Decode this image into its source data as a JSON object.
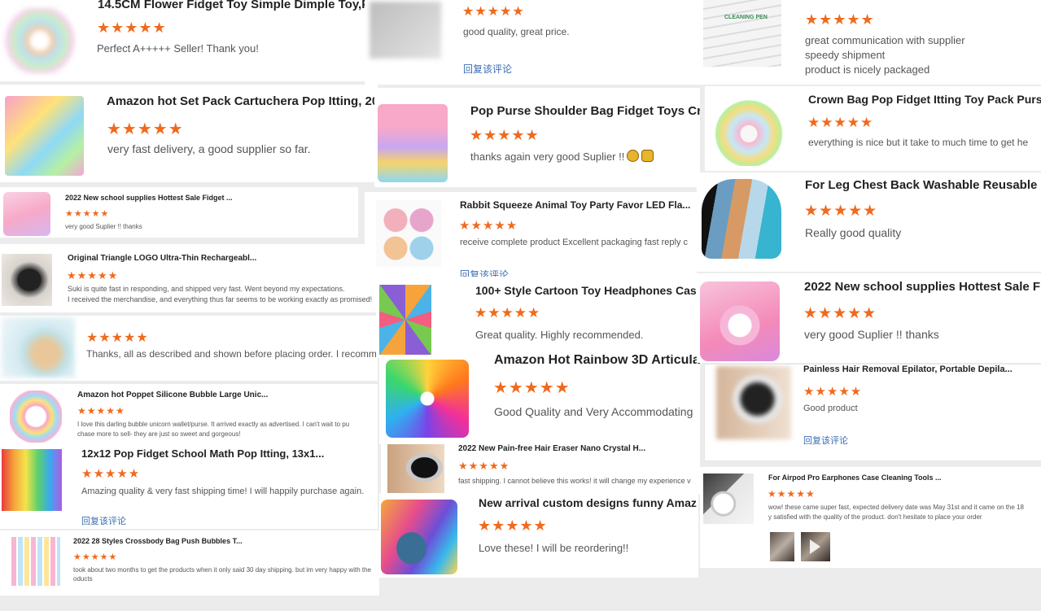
{
  "colors": {
    "star": "#f06a1d",
    "link": "#3a6db5",
    "title": "#222222",
    "text": "#555555"
  },
  "star_icon": "★★★★★",
  "reviews": [
    {
      "title": "14.5CM Flower Fidget Toy Simple Dimple Toy,P...",
      "stars": 5,
      "text": "Perfect A+++++ Seller! Thank you!"
    },
    {
      "title": "",
      "stars": 5,
      "text": "good quality, great price.",
      "link": "回复该评论"
    },
    {
      "title": "CLEANING PEN",
      "stars": 5,
      "text_lines": [
        "great communication with supplier",
        "speedy shipment",
        "product is nicely packaged"
      ]
    },
    {
      "title": "Amazon hot Set Pack Cartuchera Pop Itting, 20...",
      "stars": 5,
      "text": "very fast delivery, a good supplier so far."
    },
    {
      "title": "Pop Purse Shoulder Bag Fidget Toys Cros",
      "stars": 5,
      "text": "thanks again very good Suplier !!"
    },
    {
      "title": "Crown Bag Pop Fidget Itting Toy Pack Purse",
      "stars": 5,
      "text": "everything is nice but it take to much time to get he"
    },
    {
      "title": "2022 New school supplies Hottest Sale Fidget ...",
      "stars": 5,
      "text": "very good Suplier !! thanks"
    },
    {
      "title": "Rabbit Squeeze Animal Toy Party Favor LED Fla...",
      "stars": 5,
      "text": "receive complete product  Excellent packaging  fast reply c",
      "link": "回复该评论"
    },
    {
      "title": "For Leg Chest Back Washable Reusable F",
      "stars": 5,
      "text": "Really good quality"
    },
    {
      "title": "Original Triangle LOGO Ultra-Thin Rechargeabl...",
      "stars": 5,
      "text_lines": [
        "Suki is quite fast in responding, and shipped very fast. Went beyond my expectations.",
        "I received the merchandise, and everything thus far seems to be working exactly as promised!"
      ]
    },
    {
      "title": "100+ Style Cartoon Toy Headphones Case",
      "stars": 5,
      "text": "Great quality. Highly recommended."
    },
    {
      "title": "2022 New school supplies Hottest Sale Fi",
      "stars": 5,
      "text": "very good Suplier !! thanks"
    },
    {
      "title": "",
      "stars": 5,
      "text": "Thanks, all as described and shown before placing order. I recommend."
    },
    {
      "title": "Amazon Hot Rainbow 3D Articulat",
      "stars": 5,
      "text": "Good Quality and Very Accommodating"
    },
    {
      "title": "Painless Hair Removal Epilator, Portable Depila...",
      "stars": 5,
      "text": "Good product",
      "link": "回复该评论"
    },
    {
      "title": "Amazon hot Poppet Silicone Bubble Large Unic...",
      "stars": 5,
      "text_lines": [
        "I love this darling bubble unicorn wallet/purse.  It arrived exactly as advertised.  I can't wait to pu",
        "chase more to sell- they are just so sweet and gorgeous!"
      ]
    },
    {
      "title": "12x12 Pop Fidget School Math Pop Itting, 13x1...",
      "stars": 5,
      "text": "Amazing quality & very fast shipping time! I will happily purchase again.",
      "link": "回复该评论"
    },
    {
      "title": "2022 New Pain-free Hair Eraser Nano Crystal H...",
      "stars": 5,
      "text": "fast shipping. I cannot believe this works! it will change my experience v"
    },
    {
      "title": "For Airpod Pro Earphones Case Cleaning Tools ...",
      "stars": 5,
      "text_lines": [
        "wow! these came super fast, expected delivery date was May 31st and it came on the 18",
        "y satisfied with the quality of the product. don't hesitate to place your order"
      ]
    },
    {
      "title": "New arrival custom designs funny Amaz",
      "stars": 5,
      "text": "Love these! I will be reordering!!"
    },
    {
      "title": "2022 28 Styles Crossbody Bag Push Bubbles T...",
      "stars": 5,
      "text_lines": [
        "took about two months to get the products when it only said 30 day shipping. but im very happy with the",
        "oducts"
      ]
    }
  ]
}
